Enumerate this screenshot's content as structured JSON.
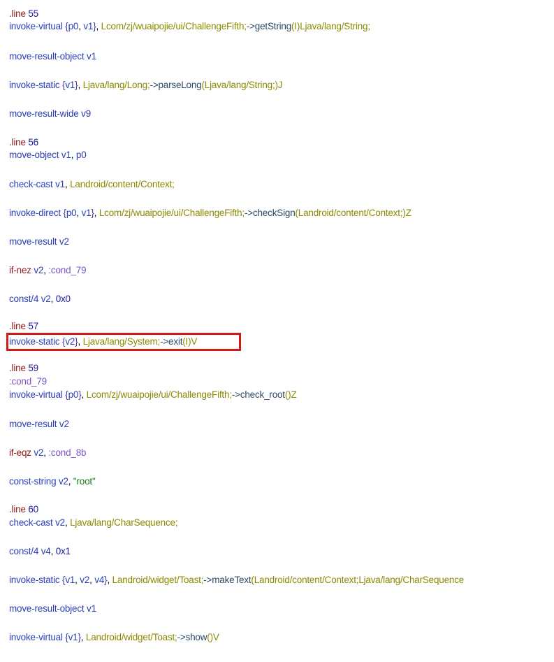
{
  "lines": {
    "l01": {
      "dir": ".line",
      "num": "55"
    },
    "l02": {
      "op": "invoke-virtual",
      "b1": "{",
      "r1": "p0",
      "s1": ",",
      "r2": "v1",
      "b2": "}",
      "s2": ",",
      "t1": "Lcom/zj/wuaipojie/ui/ChallengeFifth;",
      "m": "->getString",
      "t2": "(I)Ljava/lang/String;"
    },
    "l03": {
      "op": "move-result-object",
      "r1": "v1"
    },
    "l04": {
      "op": "invoke-static",
      "b1": "{",
      "r1": "v1",
      "b2": "}",
      "s1": ",",
      "t1": "Ljava/lang/Long;",
      "m": "->parseLong",
      "t2": "(Ljava/lang/String;)J"
    },
    "l05": {
      "op": "move-result-wide",
      "r1": "v9"
    },
    "l06": {
      "dir": ".line",
      "num": "56"
    },
    "l07": {
      "op": "move-object",
      "r1": "v1",
      "s1": ",",
      "r2": "p0"
    },
    "l08": {
      "op": "check-cast",
      "r1": "v1",
      "s1": ",",
      "t1": "Landroid/content/Context;"
    },
    "l09": {
      "op": "invoke-direct",
      "b1": "{",
      "r1": "p0",
      "s1": ",",
      "r2": "v1",
      "b2": "}",
      "s2": ",",
      "t1": "Lcom/zj/wuaipojie/ui/ChallengeFifth;",
      "m": "->checkSign",
      "t2": "(Landroid/content/Context;)Z"
    },
    "l10": {
      "op": "move-result",
      "r1": "v2"
    },
    "l11": {
      "op": "if-nez",
      "r1": "v2",
      "s1": ",",
      "lbl": ":cond_79"
    },
    "l12": {
      "op": "const/4",
      "r1": "v2",
      "s1": ",",
      "num": "0x0"
    },
    "l13": {
      "dir": ".line",
      "num": "57"
    },
    "l14": {
      "op": "invoke-static",
      "b1": "{",
      "r1": "v2",
      "b2": "}",
      "s1": ",",
      "t1": "Ljava/lang/System;",
      "m": "->exit",
      "t2": "(I)V"
    },
    "l15": {
      "dir": ".line",
      "num": "59"
    },
    "l16": {
      "lbl": ":cond_79"
    },
    "l17": {
      "op": "invoke-virtual",
      "b1": "{",
      "r1": "p0",
      "b2": "}",
      "s1": ",",
      "t1": "Lcom/zj/wuaipojie/ui/ChallengeFifth;",
      "m": "->check_root",
      "t2": "()Z"
    },
    "l18": {
      "op": "move-result",
      "r1": "v2"
    },
    "l19": {
      "op": "if-eqz",
      "r1": "v2",
      "s1": ",",
      "lbl": ":cond_8b"
    },
    "l20": {
      "op": "const-string",
      "r1": "v2",
      "s1": ",",
      "str": "\"root\""
    },
    "l21": {
      "dir": ".line",
      "num": "60"
    },
    "l22": {
      "op": "check-cast",
      "r1": "v2",
      "s1": ",",
      "t1": "Ljava/lang/CharSequence;"
    },
    "l23": {
      "op": "const/4",
      "r1": "v4",
      "s1": ",",
      "num": "0x1"
    },
    "l24": {
      "op": "invoke-static",
      "b1": "{",
      "r1": "v1",
      "s1": ",",
      "r2": "v2",
      "s2": ",",
      "r3": "v4",
      "b2": "}",
      "s3": ",",
      "t1": "Landroid/widget/Toast;",
      "m": "->makeText",
      "t2": "(Landroid/content/Context;Ljava/lang/CharSequence"
    },
    "l25": {
      "op": "move-result-object",
      "r1": "v1"
    },
    "l26": {
      "op": "invoke-virtual",
      "b1": "{",
      "r1": "v1",
      "b2": "}",
      "s1": ",",
      "t1": "Landroid/widget/Toast;",
      "m": "->show",
      "t2": "()V"
    }
  },
  "colors": {
    "directive": "#8b1a1a",
    "opcode": "#2a3fb8",
    "type": "#8a8a00",
    "method": "#2b4a66",
    "label": "#7a55c9",
    "string": "#1e7a1e",
    "highlight_border": "#d21c1c"
  }
}
